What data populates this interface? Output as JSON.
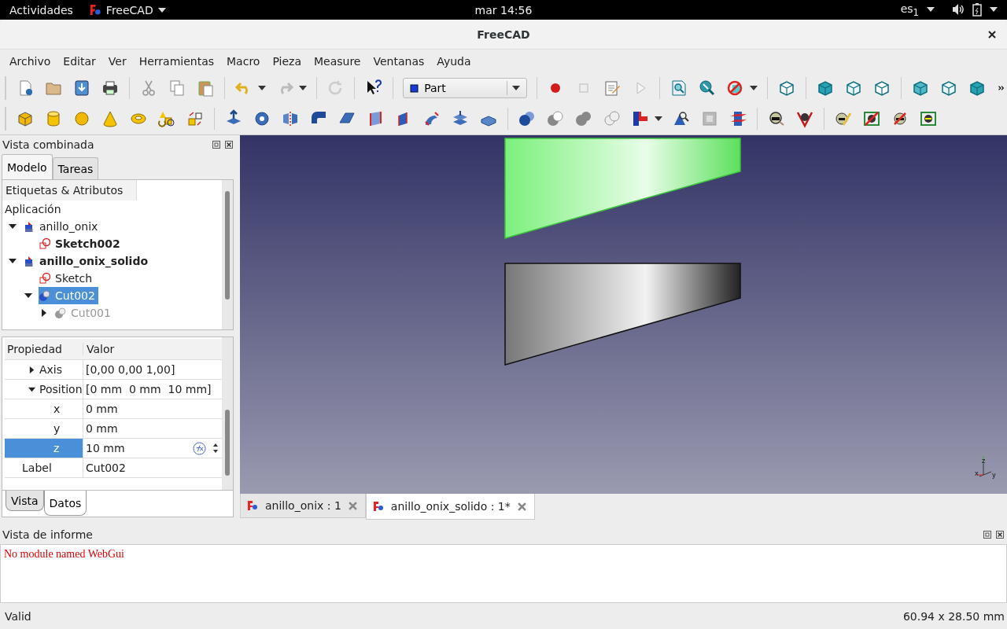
{
  "system_bar": {
    "activities": "Actividades",
    "app": "FreeCAD",
    "clock": "mar 14:56",
    "keyboard": "es$_{1}$"
  },
  "window": {
    "title": "FreeCAD"
  },
  "menu": [
    "Archivo",
    "Editar",
    "Ver",
    "Herramientas",
    "Macro",
    "Pieza",
    "Measure",
    "Ventanas",
    "Ayuda"
  ],
  "toolbar": {
    "workbench": "Part"
  },
  "combo_view": {
    "title": "Vista combinada",
    "tabs": [
      {
        "label": "Modelo",
        "selected": true
      },
      {
        "label": "Tareas",
        "selected": false
      }
    ],
    "tree": {
      "header": "Etiquetas & Atributos",
      "root": "Aplicación",
      "items": [
        {
          "label": "anillo_onix",
          "kind": "part",
          "bold": false,
          "selected": false,
          "dimmed": false,
          "expanded": true,
          "children": [
            {
              "label": "Sketch002",
              "kind": "sketch",
              "bold": true,
              "selected": false,
              "dimmed": false
            }
          ]
        },
        {
          "label": "anillo_onix_solido",
          "kind": "part",
          "bold": true,
          "selected": false,
          "dimmed": false,
          "expanded": true,
          "children": [
            {
              "label": "Sketch",
              "kind": "sketch",
              "bold": false,
              "selected": false,
              "dimmed": false
            },
            {
              "label": "Cut002",
              "kind": "cut",
              "bold": false,
              "selected": true,
              "dimmed": false,
              "expanded": true,
              "children": [
                {
                  "label": "Cut001",
                  "kind": "cut",
                  "bold": false,
                  "selected": false,
                  "dimmed": true,
                  "expanded": false
                }
              ]
            }
          ]
        }
      ]
    },
    "properties": {
      "columns": [
        "Propiedad",
        "Valor"
      ],
      "rows": [
        {
          "name": "Axis",
          "value": "[0,00 0,00 1,00]",
          "selected": false,
          "expanded": false
        },
        {
          "name": "Position",
          "value": "[0 mm  0 mm  10 mm]",
          "selected": false,
          "expanded": true,
          "children": [
            {
              "name": "x",
              "value": "0 mm",
              "selected": false
            },
            {
              "name": "y",
              "value": "0 mm",
              "selected": false
            },
            {
              "name": "z",
              "value": "10 mm",
              "selected": true
            }
          ]
        },
        {
          "name": "Label",
          "value": "Cut002",
          "selected": false
        }
      ]
    },
    "bottom_tabs": [
      {
        "label": "Vista",
        "selected": false
      },
      {
        "label": "Datos",
        "selected": true
      }
    ]
  },
  "view3d": {
    "axis_labels": [
      "z",
      "x",
      "y"
    ]
  },
  "document_tabs": [
    {
      "label": "anillo_onix : 1",
      "selected": false
    },
    {
      "label": "anillo_onix_solido : 1*",
      "selected": true
    }
  ],
  "report_view": {
    "title": "Vista de informe",
    "messages": [
      {
        "text": "No module named WebGui",
        "kind": "error"
      }
    ]
  },
  "status_bar": {
    "message": "Valid",
    "dimensions": "60.94 x 28.50 mm"
  }
}
